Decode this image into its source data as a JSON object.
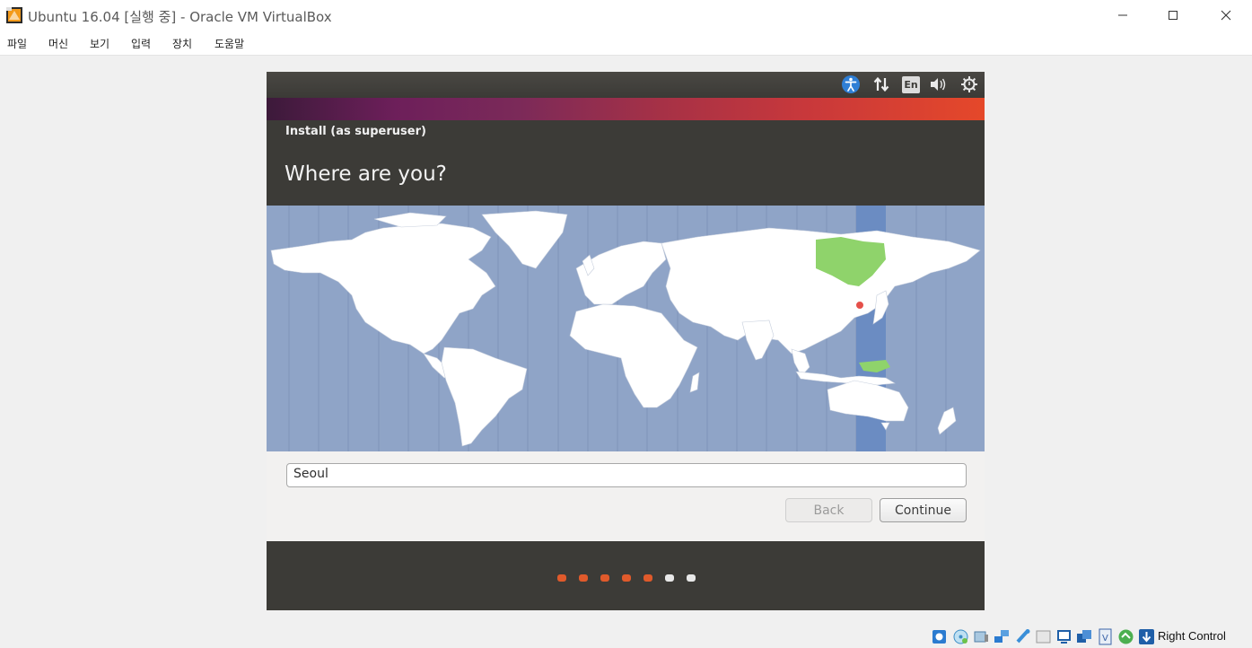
{
  "window": {
    "title": "Ubuntu 16.04 [실행 중] - Oracle VM VirtualBox"
  },
  "menu": [
    "파일",
    "머신",
    "보기",
    "입력",
    "장치",
    "도움말"
  ],
  "guest": {
    "tray": {
      "keyboard_layout": "En"
    },
    "dialog": {
      "subtitle": "Install (as superuser)",
      "title": "Where are you?"
    },
    "map": {
      "selected_city": "Seoul"
    },
    "location_field": {
      "value": "Seoul"
    },
    "buttons": {
      "back": "Back",
      "continue": "Continue"
    },
    "progress": {
      "total_steps": 7,
      "completed_steps": 5,
      "color_done": "#e05a2b",
      "color_todo": "#e8e8e8"
    }
  },
  "statusbar": {
    "host_key": "Right Control",
    "icons": [
      "hard-disk-icon",
      "optical-drive-icon",
      "audio-icon",
      "network-icon",
      "usb-icon",
      "shared-folders-icon",
      "display-icon",
      "recording-icon",
      "cpu-virtualization-icon",
      "guest-additions-icon",
      "host-key-arrow-icon"
    ]
  },
  "colors": {
    "ubuntu_dark": "#3c3b37",
    "ocean": "#8fa4c7",
    "timezone_highlight": "#6b8cc2",
    "selected_region": "#8fd36b"
  }
}
